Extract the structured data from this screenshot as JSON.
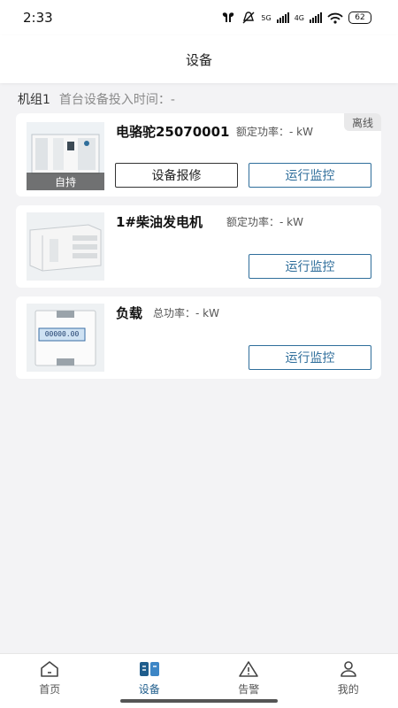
{
  "status_bar": {
    "time": "2:33",
    "net_5g": "5G",
    "net_4g": "4G",
    "battery": "62"
  },
  "header": {
    "title": "设备"
  },
  "group": {
    "name": "机组1",
    "first_time_label": "首台设备投入时间：-"
  },
  "devices": [
    {
      "name": "电骆驼25070001",
      "power": "额定功率：- kW",
      "status": "离线",
      "caption": "自持",
      "repair_label": "设备报修",
      "monitor_label": "运行监控"
    },
    {
      "name": "1#柴油发电机",
      "power": "额定功率：- kW",
      "monitor_label": "运行监控"
    },
    {
      "name": "负载",
      "power": "总功率：- kW",
      "meter_reading": "00000.00",
      "monitor_label": "运行监控"
    }
  ],
  "nav": [
    {
      "label": "首页",
      "icon": "home-icon"
    },
    {
      "label": "设备",
      "icon": "device-icon"
    },
    {
      "label": "告警",
      "icon": "alert-icon"
    },
    {
      "label": "我的",
      "icon": "user-icon"
    }
  ],
  "colors": {
    "accent": "#2f6e9b",
    "nav_active": "#1f5d8c"
  }
}
